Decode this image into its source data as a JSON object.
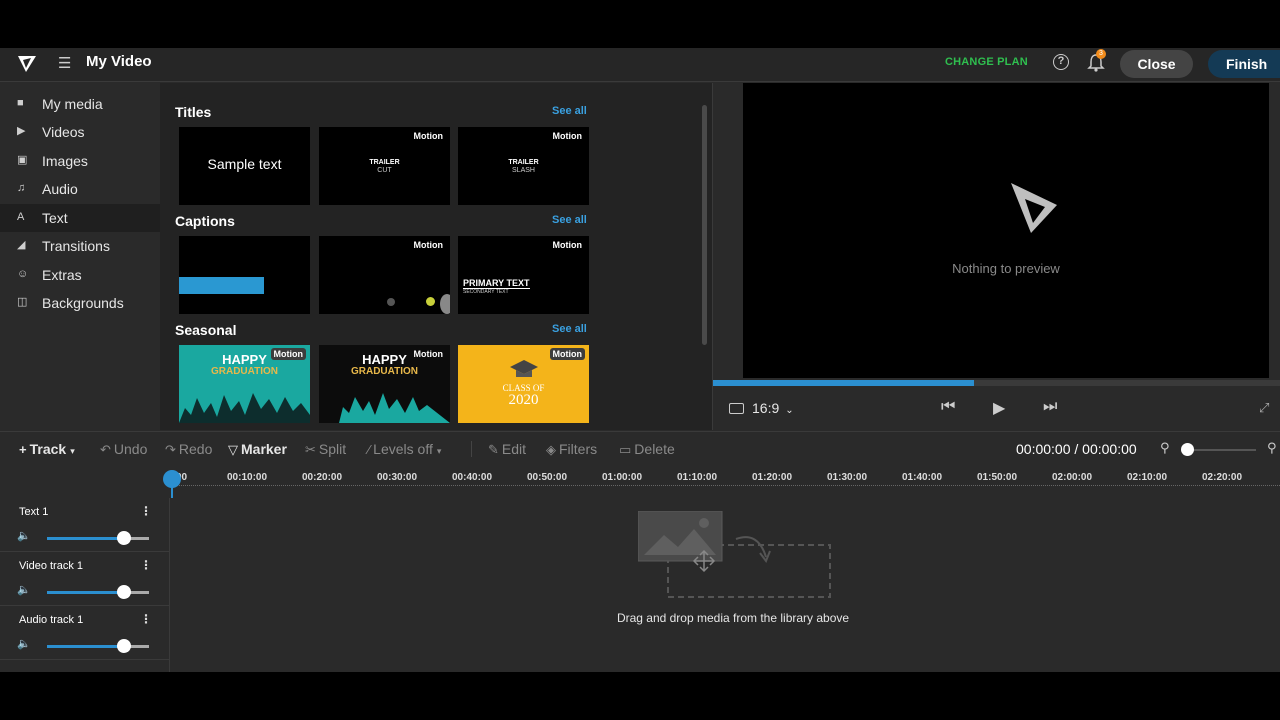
{
  "header": {
    "title": "My Video",
    "change_plan": "CHANGE PLAN",
    "notifications_count": "3",
    "close_label": "Close",
    "finish_label": "Finish"
  },
  "sidebar": {
    "items": [
      {
        "label": "My media",
        "icon": "folder-icon"
      },
      {
        "label": "Videos",
        "icon": "video-icon"
      },
      {
        "label": "Images",
        "icon": "image-icon"
      },
      {
        "label": "Audio",
        "icon": "music-note-icon"
      },
      {
        "label": "Text",
        "icon": "text-icon",
        "active": true
      },
      {
        "label": "Transitions",
        "icon": "transition-icon"
      },
      {
        "label": "Extras",
        "icon": "smiley-icon"
      },
      {
        "label": "Backgrounds",
        "icon": "backgrounds-icon"
      }
    ]
  },
  "library": {
    "sections": [
      {
        "title": "Titles",
        "see_all": "See all",
        "items": [
          {
            "text": "Sample text"
          },
          {
            "badge": "Motion",
            "line1": "TRAILER",
            "line2": "CUT"
          },
          {
            "badge": "Motion",
            "line1": "TRAILER",
            "line2": "SLASH"
          }
        ]
      },
      {
        "title": "Captions",
        "see_all": "See all",
        "items": [
          {},
          {
            "badge": "Motion"
          },
          {
            "badge": "Motion",
            "line1": "PRIMARY TEXT",
            "line2": "SECONDARY TEXT"
          }
        ]
      },
      {
        "title": "Seasonal",
        "see_all": "See all",
        "items": [
          {
            "badge": "Motion",
            "line1": "HAPPY",
            "line2": "GRADUATION"
          },
          {
            "badge": "Motion",
            "line1": "HAPPY",
            "line2": "GRADUATION"
          },
          {
            "badge": "Motion",
            "line1": "CLASS OF",
            "line2": "2020"
          }
        ]
      }
    ]
  },
  "preview": {
    "empty_text": "Nothing to preview",
    "aspect_ratio": "16:9",
    "progress": 0.46
  },
  "toolbar": {
    "track": "Track",
    "undo": "Undo",
    "redo": "Redo",
    "marker": "Marker",
    "split": "Split",
    "levels": "Levels off",
    "edit": "Edit",
    "filters": "Filters",
    "delete": "Delete",
    "timecode": "00:00:00 / 00:00:00"
  },
  "ruler": {
    "ticks": [
      "00",
      "00:10:00",
      "00:20:00",
      "00:30:00",
      "00:40:00",
      "00:50:00",
      "01:00:00",
      "01:10:00",
      "01:20:00",
      "01:30:00",
      "01:40:00",
      "01:50:00",
      "02:00:00",
      "02:10:00",
      "02:20:00"
    ]
  },
  "tracks": [
    {
      "name": "Text 1",
      "volume": 0.75
    },
    {
      "name": "Video track 1",
      "volume": 0.75
    },
    {
      "name": "Audio track 1",
      "volume": 0.75
    }
  ],
  "timeline": {
    "drop_text": "Drag and drop media from the library above"
  },
  "colors": {
    "accent": "#2b8fd0",
    "change_plan": "#2fbf4f",
    "motion_badge": "#3c3c3c",
    "teal": "#1aa8a0",
    "gold": "#f4b41a"
  }
}
